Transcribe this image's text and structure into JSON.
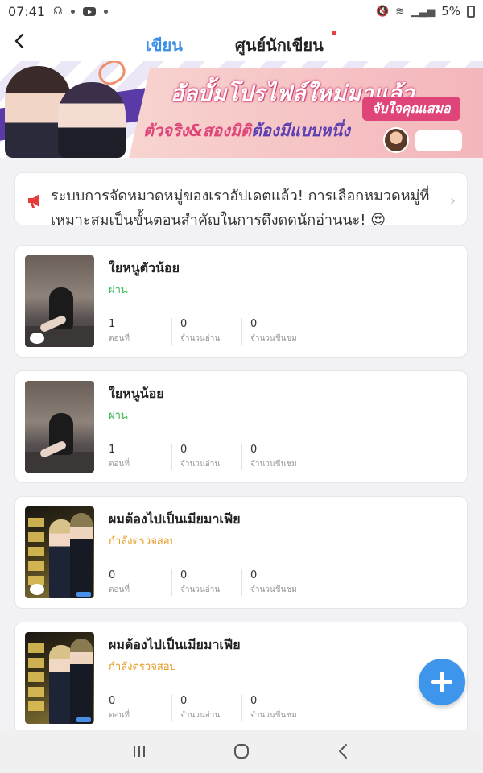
{
  "status_bar": {
    "time": "07:41",
    "battery": "5%"
  },
  "nav": {
    "tab_write": "เขียน",
    "tab_writer_center": "ศูนย์นักเขียน"
  },
  "banner": {
    "title": "อัลบั้มโปรไฟล์ใหม่มาแล้ว",
    "subtitle_part1": "ตัวจริง&สองมิติ",
    "subtitle_part2": "ต้องมีแบบหนึ่ง",
    "badge": "จับใจคุณเสมอ"
  },
  "notice": {
    "text": "ระบบการจัดหมวดหมู่ของเราอัปเดตแล้ว! การเลือกหมวดหมู่ที่เหมาะสมเป็นขั้นตอนสำคัญในการดึงดูดนักอ่านนะ! 😍"
  },
  "stories": [
    {
      "title": "ใยหนูตัวน้อย",
      "status": "ผ่าน",
      "status_color": "#2fb34a",
      "episodes": "1",
      "reads": "0",
      "likes": "0",
      "label_episodes": "ตอนที่",
      "label_reads": "จำนวนอ่าน",
      "label_likes": "จำนวนชื่นชม"
    },
    {
      "title": "ใยหนูน้อย",
      "status": "ผ่าน",
      "status_color": "#2fb34a",
      "episodes": "1",
      "reads": "0",
      "likes": "0",
      "label_episodes": "ตอนที่",
      "label_reads": "จำนวนอ่าน",
      "label_likes": "จำนวนชื่นชม"
    },
    {
      "title": "ผมต้องไปเป็นเมียมาเฟีย",
      "status": "กำลังตรวจสอบ",
      "status_color": "#e59a1f",
      "episodes": "0",
      "reads": "0",
      "likes": "0",
      "label_episodes": "ตอนที่",
      "label_reads": "จำนวนอ่าน",
      "label_likes": "จำนวนชื่นชม"
    },
    {
      "title": "ผมต้องไปเป็นเมียมาเฟีย",
      "status": "กำลังตรวจสอบ",
      "status_color": "#e59a1f",
      "episodes": "0",
      "reads": "0",
      "likes": "0",
      "label_episodes": "ตอนที่",
      "label_reads": "จำนวนอ่าน",
      "label_likes": "จำนวนชื่นชม"
    }
  ],
  "icons": {
    "back": "back-arrow-icon",
    "fab": "plus-icon",
    "notice": "megaphone-icon",
    "chevron": "chevron-right-icon"
  },
  "colors": {
    "accent": "#3b8fe6",
    "fab": "#3d95ec"
  }
}
